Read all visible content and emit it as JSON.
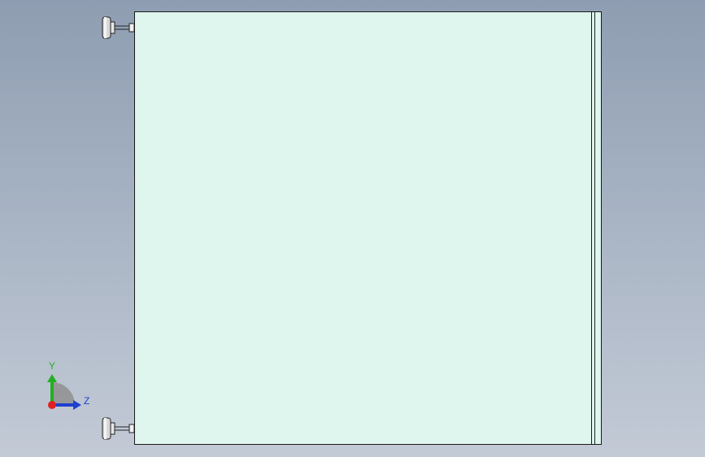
{
  "viewport": {
    "background_top": "#8e9db1",
    "background_bottom": "#c3cad6"
  },
  "part": {
    "face_color": "#dff6ef",
    "outline_color": "#1a1a1a"
  },
  "triad": {
    "y_label": "Y",
    "z_label": "Z",
    "y_color": "#22b022",
    "z_color": "#1f3fcf",
    "x_color": "#e02020"
  },
  "icons": [
    "leveling-foot-icon",
    "view-orientation-triad-icon"
  ]
}
